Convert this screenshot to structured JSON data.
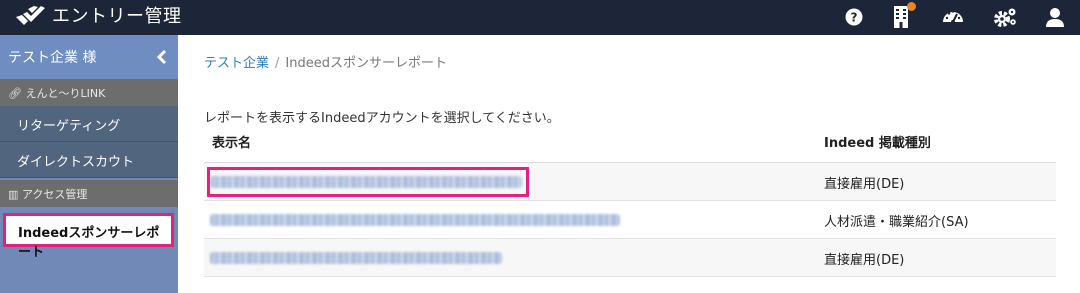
{
  "app": {
    "title": "エントリー管理"
  },
  "topbar": {
    "icons": [
      {
        "name": "help-icon"
      },
      {
        "name": "building-icon"
      },
      {
        "name": "dashboard-icon"
      },
      {
        "name": "settings-icon"
      },
      {
        "name": "user-icon"
      }
    ],
    "notification_color": "#e88526"
  },
  "sidebar": {
    "company_label": "テスト企業 様",
    "sections": [
      {
        "label": "えんと〜りLINK",
        "icon": "link-icon"
      },
      {
        "label": "アクセス管理",
        "icon": "bar-chart-icon"
      }
    ],
    "items": [
      {
        "label": "リターゲティング"
      },
      {
        "label": "ダイレクトスカウト"
      },
      {
        "label": "Indeedスポンサーレポート"
      }
    ],
    "highlight_color": "#e0247d"
  },
  "breadcrumb": {
    "root": "テスト企業",
    "separator": "/",
    "current": "Indeedスポンサーレポート"
  },
  "main": {
    "instruction": "レポートを表示するIndeedアカウントを選択してください。",
    "table": {
      "columns": [
        "表示名",
        "Indeed 掲載種別"
      ],
      "rows": [
        {
          "type": "直接雇用(DE)"
        },
        {
          "type": "人材派遣・職業紹介(SA)"
        },
        {
          "type": "直接雇用(DE)"
        }
      ]
    }
  }
}
